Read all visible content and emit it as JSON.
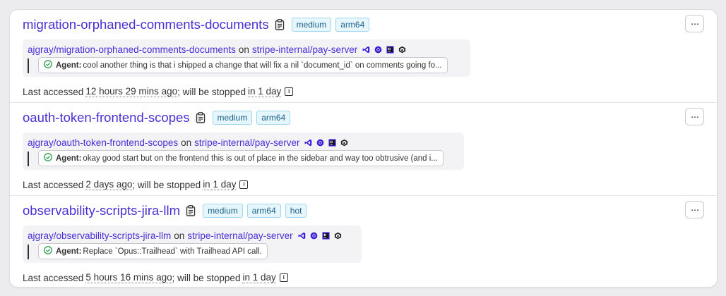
{
  "workspaces": [
    {
      "title": "migration-orphaned-comments-documents",
      "tags": [
        "medium",
        "arm64"
      ],
      "branch": "ajgray/migration-orphaned-comments-documents",
      "on": "on",
      "repo": "stripe-internal/pay-server",
      "agent_label": "Agent:",
      "agent_message": "cool another thing is that i shipped a change that will fix a nil `document_id` on comments going fo...",
      "last_prefix": "Last accessed",
      "last_time": "12 hours 29 mins ago",
      "stop_mid": "; will be stopped",
      "stop_time": "in 1 day",
      "more_label": "···"
    },
    {
      "title": "oauth-token-frontend-scopes",
      "tags": [
        "medium",
        "arm64"
      ],
      "branch": "ajgray/oauth-token-frontend-scopes",
      "on": "on",
      "repo": "stripe-internal/pay-server",
      "agent_label": "Agent:",
      "agent_message": "okay good start but on the frontend this is out of place in the sidebar and way too obtrusive (and i...",
      "last_prefix": "Last accessed",
      "last_time": "2 days ago",
      "stop_mid": "; will be stopped",
      "stop_time": "in 1 day",
      "more_label": "···"
    },
    {
      "title": "observability-scripts-jira-llm",
      "tags": [
        "medium",
        "arm64",
        "hot"
      ],
      "branch": "ajgray/observability-scripts-jira-llm",
      "on": "on",
      "repo": "stripe-internal/pay-server",
      "agent_label": "Agent:",
      "agent_message": "Replace `Opus::Trailhead` with Trailhead API call.",
      "last_prefix": "Last accessed",
      "last_time": "5 hours 16 mins ago",
      "stop_mid": "; will be stopped",
      "stop_time": "in 1 day",
      "more_label": "···"
    }
  ],
  "icons": [
    "vscode-icon",
    "chrome-icon",
    "jetbrains-icon",
    "terminal-icon"
  ],
  "colors": {
    "link": "#4b2fd6",
    "tag_bg": "#e5f6fc",
    "tag_border": "#9fd7ec",
    "check": "#2e9d4e"
  }
}
